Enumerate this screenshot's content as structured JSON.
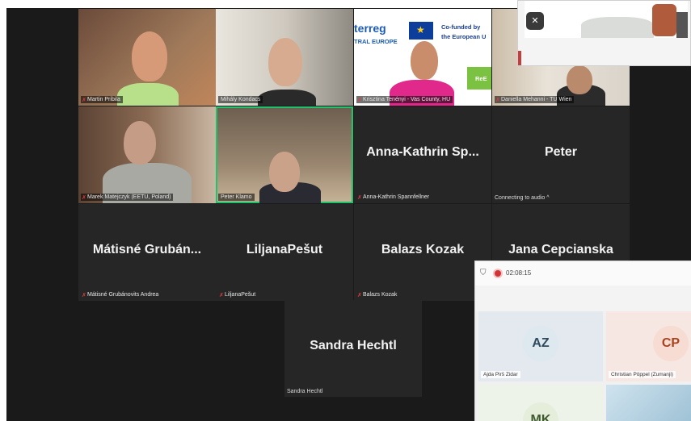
{
  "zoom": {
    "tiles": [
      {
        "id": "martin",
        "label": "Martin Pribila",
        "muted": true
      },
      {
        "id": "mihaly",
        "label": "Mihály Kondacs",
        "muted": false
      },
      {
        "id": "krisztina",
        "label": "Krisztina Tenényi - Vas County, HU",
        "muted": true,
        "poster_left": "terreg",
        "poster_left2": "TRAL EUROPE",
        "poster_right1": "Co-funded by",
        "poster_right2": "the European U",
        "poster_re": "ReE"
      },
      {
        "id": "daniella",
        "label": "Daniella Mehanni - TU Wien",
        "muted": true
      },
      {
        "id": "marek",
        "label": "Marek Matejczyk (EETU, Poland)",
        "muted": true
      },
      {
        "id": "peterk",
        "label": "Peter Klamo",
        "muted": false
      },
      {
        "id": "annakathrin",
        "display": "Anna-Kathrin  Sp...",
        "label": "Anna-Kathrin Spannfellner",
        "muted": true
      },
      {
        "id": "peter",
        "display": "Peter",
        "label": "Connecting to audio ^",
        "muted": false
      },
      {
        "id": "matisne",
        "display": "Mátisné  Grubán...",
        "label": "Mátisné Grubánovits Andrea",
        "muted": true
      },
      {
        "id": "liljana",
        "display": "LiljanaPešut",
        "label": "LiljanaPešut",
        "muted": true
      },
      {
        "id": "balazs",
        "display": "Balazs Kozak",
        "label": "Balazs Kozak",
        "muted": true
      },
      {
        "id": "jana",
        "display": "Jana Cepcianska",
        "label": "",
        "muted": false
      },
      {
        "id": "sandra",
        "display": "Sandra Hechtl",
        "label": "Sandra Hechtl",
        "muted": false
      }
    ]
  },
  "teams": {
    "timer": "02:08:15",
    "participants": [
      {
        "initials": "AZ",
        "label": "Ajda Pirš Zidar",
        "avatar_bg": "#dde8ef",
        "avatar_fg": "#2f4a5c"
      },
      {
        "initials": "CP",
        "label": "Christian Pöppel (Zumanji)",
        "avatar_bg": "#f6dcd2",
        "avatar_fg": "#a8431f"
      },
      {
        "initials": "MK",
        "label": "",
        "avatar_bg": "#e4eedb",
        "avatar_fg": "#3f5a2e"
      }
    ]
  },
  "icons": {
    "mute": "mic-muted-icon",
    "shield": "shield-icon",
    "record": "record-icon"
  },
  "colors": {
    "active_speaker": "#23c16b",
    "zoom_bg": "#1a1a1a",
    "tile_bg": "#262626",
    "mute_red": "#e03c3c",
    "rec_red": "#d13438"
  }
}
